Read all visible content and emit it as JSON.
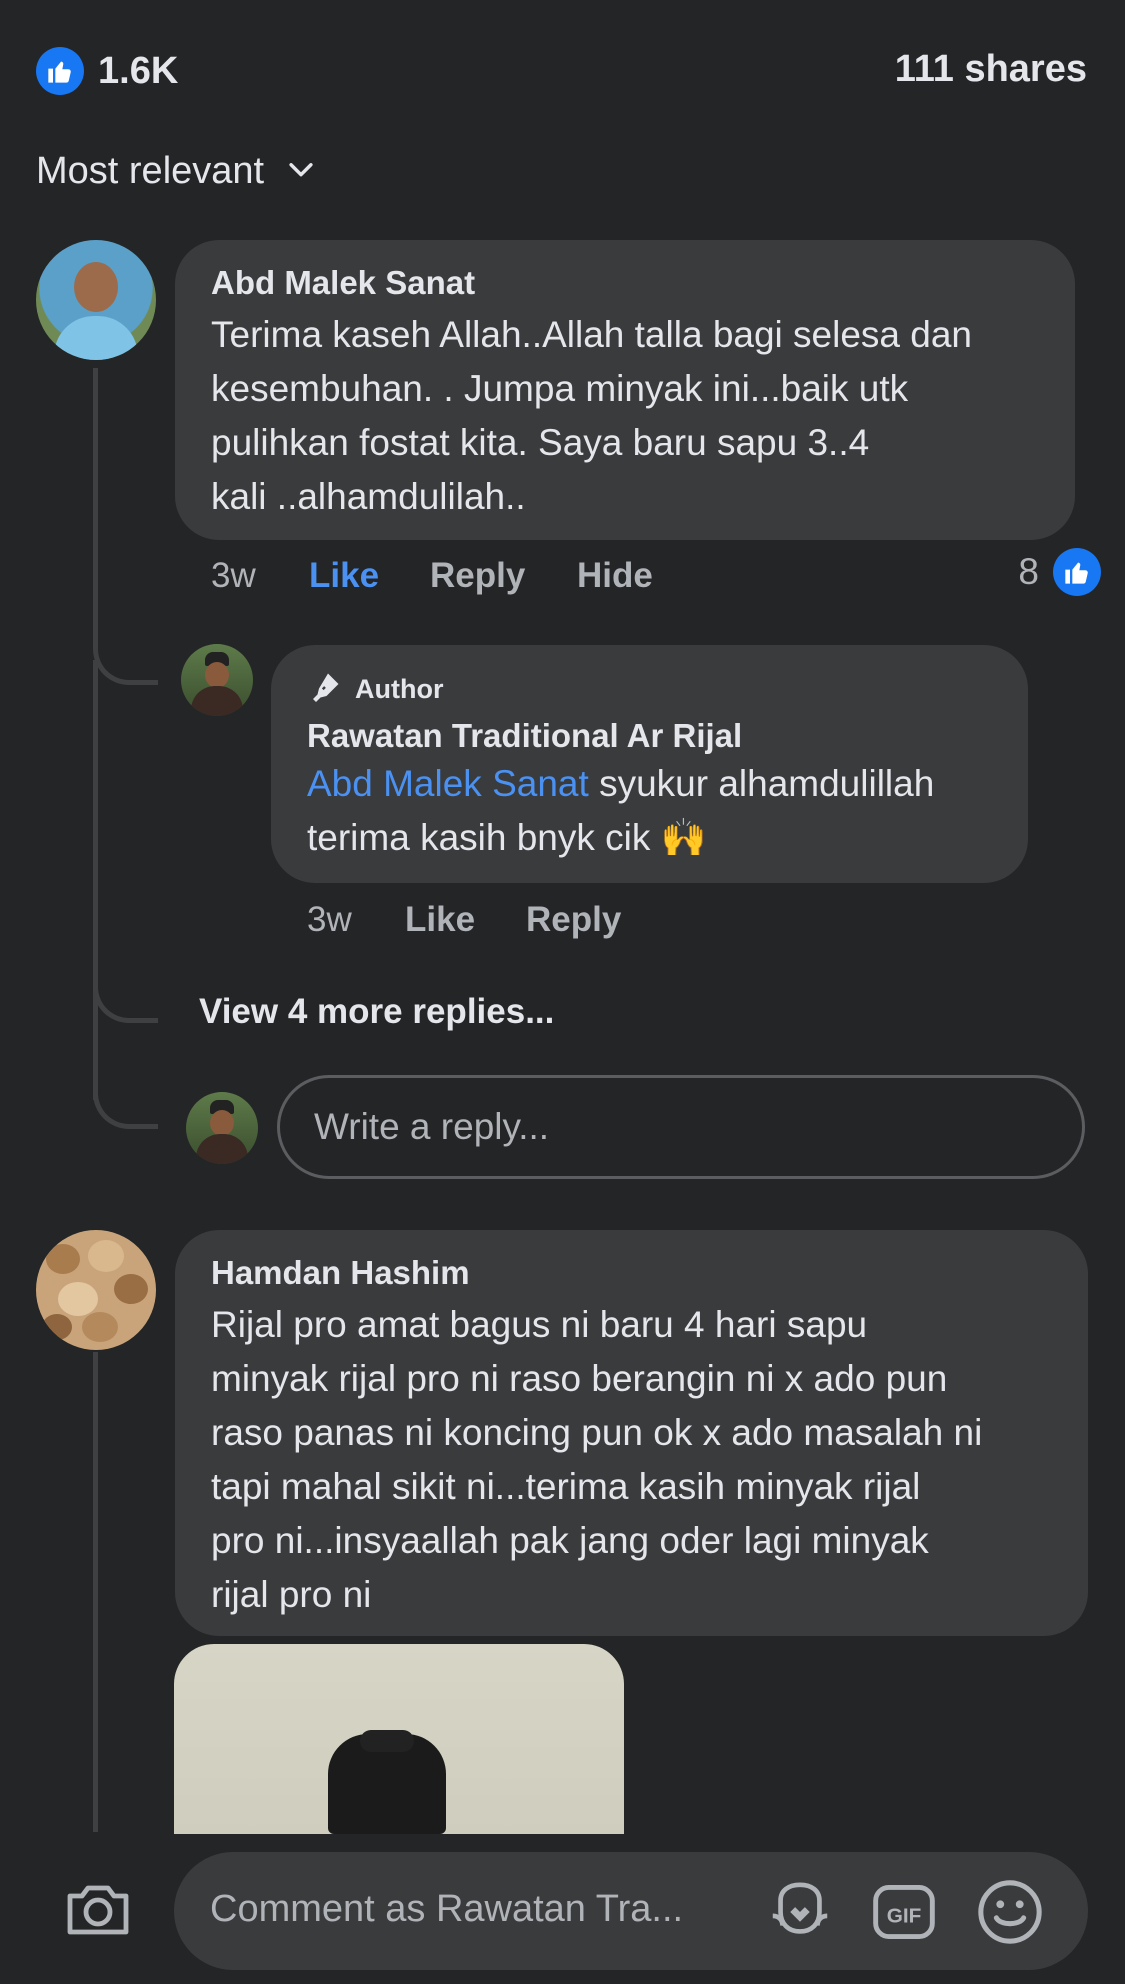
{
  "summary": {
    "like_count": "1.6K",
    "shares": "111 shares",
    "like_color": "#1877f2"
  },
  "filter": {
    "label": "Most relevant"
  },
  "comments": [
    {
      "author": "Abd Malek Sanat",
      "text_lines": [
        "Terima kaseh Allah..Allah talla bagi selesa dan",
        "kesembuhan. . Jumpa minyak ini...baik utk",
        "pulihkan fostat kita. Saya baru sapu 3..4",
        "kali ..alhamdulilah.."
      ],
      "time": "3w",
      "like": "Like",
      "reply": "Reply",
      "hide": "Hide",
      "reaction_count": "8"
    },
    {
      "author": "Hamdan Hashim",
      "text_lines": [
        "Rijal pro amat bagus ni baru 4 hari sapu",
        "minyak rijal pro ni raso berangin ni  x ado pun",
        "raso panas ni koncing pun ok x ado masalah ni",
        "tapi mahal sikit ni...terima kasih minyak rijal",
        "pro ni...insyaallah pak jang oder lagi minyak",
        "rijal pro ni"
      ]
    }
  ],
  "reply": {
    "badge": "Author",
    "author": "Rawatan Traditional Ar Rijal",
    "mention": "Abd Malek Sanat",
    "text_line1": " syukur alhamdulillah",
    "text_line2": "terima kasih bnyk cik",
    "emoji": "🙌",
    "time": "3w",
    "like": "Like",
    "reply": "Reply"
  },
  "view_more": "View 4 more replies...",
  "reply_box": {
    "placeholder": "Write a reply..."
  },
  "composer": {
    "placeholder": "Comment as Rawatan Tra..."
  },
  "icons": {
    "like": "like-thumb-icon",
    "chevron": "chevron-down-icon",
    "camera": "camera-icon",
    "avatar_frame": "avatar-frame-icon",
    "gif": "gif-icon",
    "emoji": "smiley-icon",
    "pen": "pen-icon"
  }
}
